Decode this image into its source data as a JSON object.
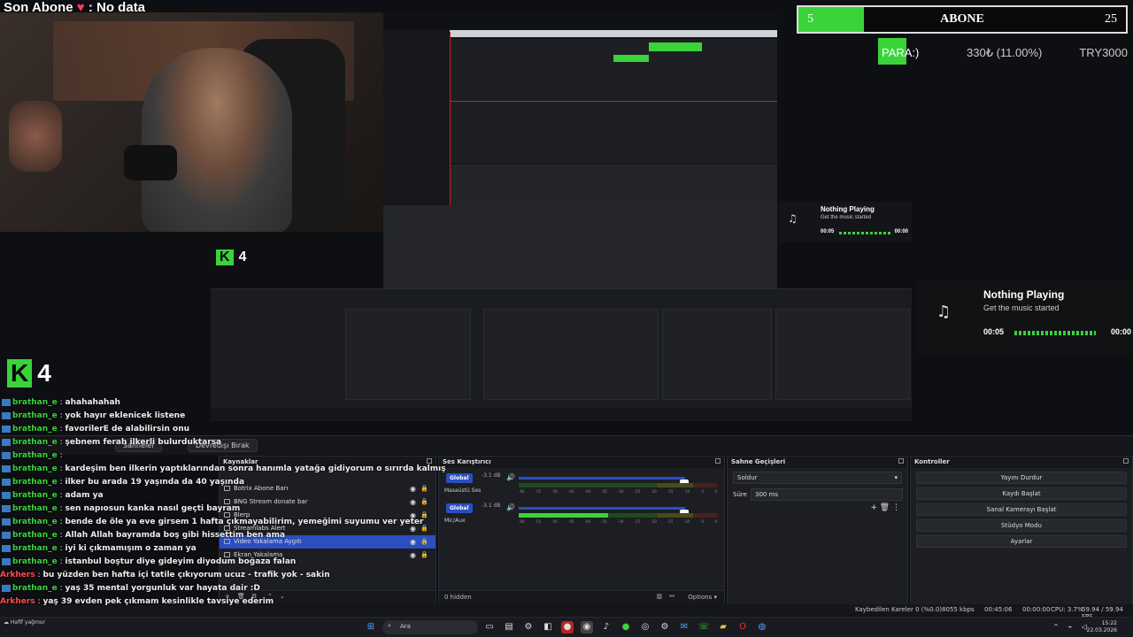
{
  "overlay": {
    "sub_title_prefix": "Son Abone",
    "sub_title_heart": "♥",
    "sub_title_suffix": ": No data",
    "abone_label": "ABONE",
    "abone_current": "5",
    "abone_goal": "25",
    "abone_progress": 0.2,
    "donation_label": "PARA:)",
    "donation_amount": "330₺ (11.00%)",
    "donation_goal": "TRY3000",
    "k_badge": "4",
    "k_letter": "K",
    "colors": {
      "accent": "#3ad33a",
      "selection": "#2b4fc0"
    }
  },
  "now_playing": {
    "title": "Nothing Playing",
    "subtitle": "Get the music started",
    "time_start": "00:05",
    "time_end": "00:00",
    "icon": "music-icon"
  },
  "chat": [
    {
      "user": "brathan_e",
      "msg": "ahahahahah"
    },
    {
      "user": "brathan_e",
      "msg": "yok hayır eklenicek listene"
    },
    {
      "user": "brathan_e",
      "msg": "favorilerE de alabilirsin onu"
    },
    {
      "user": "brathan_e",
      "msg": "şebnem ferah ilkerli bulurduktarsa"
    },
    {
      "user": "brathan_e",
      "msg": ""
    },
    {
      "user": "brathan_e",
      "msg": "kardeşim ben ilkerin yaptıklarından sonra hanımla yatağa gidiyorum o sırırda kalmış"
    },
    {
      "user": "brathan_e",
      "msg": "ilker bu arada 19 yaşında da 40 yaşında"
    },
    {
      "user": "brathan_e",
      "msg": "adam ya"
    },
    {
      "user": "brathan_e",
      "msg": "sen napıosun kanka nasıl geçti bayram"
    },
    {
      "user": "brathan_e",
      "msg": "bende de öle ya eve girsem 1 hafta çıkmayabilirim, yemeğimi suyumu ver yeter"
    },
    {
      "user": "brathan_e",
      "msg": "Allah Allah bayramda boş gibi hissettim ben ama"
    },
    {
      "user": "brathan_e",
      "msg": "iyi ki çıkmamışım o zaman ya"
    },
    {
      "user": "brathan_e",
      "msg": "istanbul boştur diye gideyim diyodum boğaza falan"
    },
    {
      "user": "Arkhers",
      "msg": "bu yüzden ben hafta içi tatile çıkıyorum ucuz - trafik yok - sakin"
    },
    {
      "user": "brathan_e",
      "msg": "yaş 35 mental yorgunluk var hayata dair :D"
    },
    {
      "user": "Arkhers",
      "msg": "yaş 39 evden pek çıkmam kesinlikle tavsiye ederim"
    }
  ],
  "obs": {
    "toolbar": {
      "btn_disable": "Devredışı Bırak",
      "btn_scene": "Sahneler"
    },
    "sources": {
      "title": "Kaynaklar",
      "items": [
        {
          "label": "Botrix Abone Barı",
          "selected": false
        },
        {
          "label": "BNG Stream donate bar",
          "selected": false
        },
        {
          "label": "Blerp",
          "selected": false
        },
        {
          "label": "Streamlabs Alert",
          "selected": false
        },
        {
          "label": "Video Yakalama Aygıtı",
          "selected": true
        },
        {
          "label": "Ekran Yakalama",
          "selected": false
        }
      ]
    },
    "mixer": {
      "title": "Ses Karıştırıcı",
      "channels": [
        {
          "label": "Global",
          "name": "Masaüstü Ses",
          "db": "-3.1 dB",
          "level": 0.0
        },
        {
          "label": "Global",
          "name": "Mic/Aux",
          "db": "-3.1 dB",
          "level": 0.45
        }
      ],
      "ticks": [
        "-60",
        "-55",
        "-50",
        "-45",
        "-40",
        "-35",
        "-30",
        "-25",
        "-20",
        "-15",
        "-10",
        "-5",
        "0"
      ],
      "hidden": "0 hidden",
      "options": "Options"
    },
    "transitions": {
      "title": "Sahne Geçişleri",
      "type": "Soldur",
      "duration_label": "Süre",
      "duration": "300 ms"
    },
    "controls": {
      "title": "Kontroller",
      "buttons": [
        "Yayını Durdur",
        "Kaydı Başlat",
        "Sanal Kamerayı Başlat",
        "Stüdyo Modu",
        "Ayarlar"
      ]
    },
    "status": {
      "dropped": "Kaybedilen Kareler 0 (%0.0)",
      "bitrate": "8055 kbps",
      "live_time": "00:45:06",
      "rec_time": "00:00:00",
      "cpu": "CPU: 3.7%",
      "fps": "59.94 / 59.94 FPS"
    }
  },
  "taskbar": {
    "search": "Ara",
    "time": "15:22",
    "date": "22.03.2026",
    "weather": "Hafif yağmur"
  }
}
